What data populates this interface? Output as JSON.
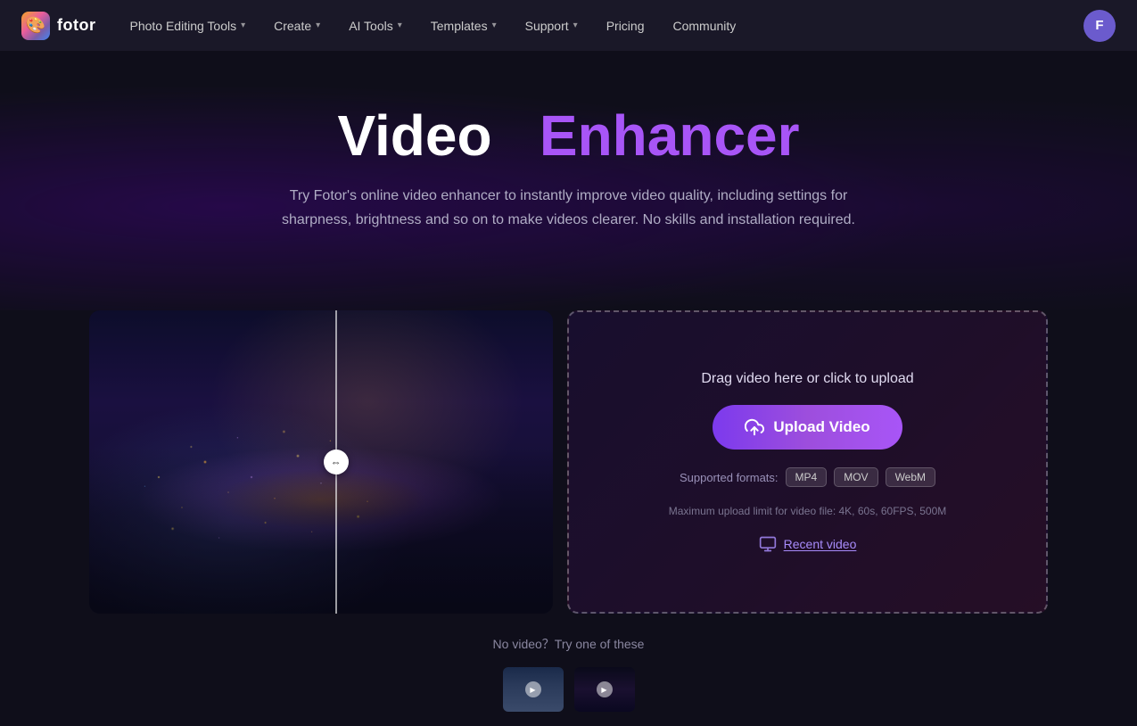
{
  "nav": {
    "logo_text": "fotor",
    "items": [
      {
        "label": "Photo Editing Tools",
        "has_dropdown": true
      },
      {
        "label": "Create",
        "has_dropdown": true
      },
      {
        "label": "AI Tools",
        "has_dropdown": true
      },
      {
        "label": "Templates",
        "has_dropdown": true
      },
      {
        "label": "Support",
        "has_dropdown": true
      },
      {
        "label": "Pricing",
        "has_dropdown": false
      },
      {
        "label": "Community",
        "has_dropdown": false
      }
    ],
    "avatar_letter": "F"
  },
  "hero": {
    "title_white": "Video",
    "title_purple": "Enhancer",
    "subtitle": "Try Fotor's online video enhancer to instantly improve video quality, including settings for sharpness, brightness and so on to make videos clearer. No skills and installation required."
  },
  "upload_box": {
    "drag_text": "Drag video here or click to upload",
    "button_label": "Upload Video",
    "formats_label": "Supported formats:",
    "format_mp4": "MP4",
    "format_mov": "MOV",
    "format_webm": "WebM",
    "limit_text": "Maximum upload limit for video file: 4K, 60s, 60FPS, 500M",
    "recent_video_label": "Recent video"
  },
  "bottom": {
    "no_video_text": "No video？Try one of these"
  }
}
